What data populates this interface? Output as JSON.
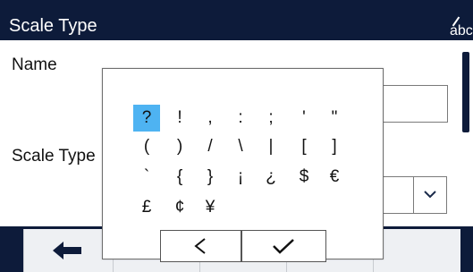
{
  "header": {
    "title": "Scale Type",
    "input_mode_icon_text": "abc"
  },
  "form": {
    "name_label": "Name",
    "scale_type_label": "Scale Type"
  },
  "char_popup": {
    "rows": [
      [
        "?",
        "!",
        ",",
        ":",
        ";",
        "'",
        "\""
      ],
      [
        "(",
        ")",
        "/",
        "\\",
        "|",
        "[",
        "]"
      ],
      [
        "`",
        "{",
        "}",
        "¡",
        "¿",
        "$",
        "€"
      ],
      [
        "£",
        "¢",
        "¥"
      ]
    ],
    "selected": "?",
    "back_icon": "chevron-left-icon",
    "ok_icon": "checkmark-icon"
  },
  "softkeys": {
    "back_icon": "arrow-left-icon"
  },
  "colors": {
    "header_bg": "#0d1b3a",
    "selected_bg": "#4eb3f2",
    "softkey_bg": "#eef0f3"
  }
}
